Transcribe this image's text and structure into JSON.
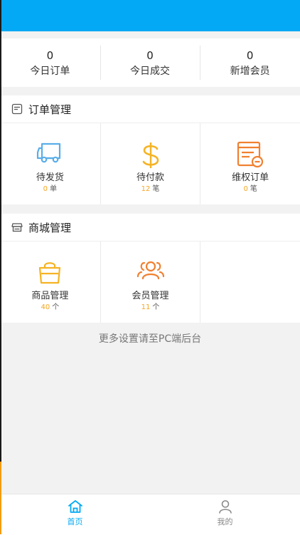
{
  "stats": [
    {
      "value": "0",
      "label": "今日订单"
    },
    {
      "value": "0",
      "label": "今日成交"
    },
    {
      "value": "0",
      "label": "新增会员"
    }
  ],
  "orders": {
    "title": "订单管理",
    "items": [
      {
        "label": "待发货",
        "count": "0",
        "unit": "单",
        "icon": "truck-icon"
      },
      {
        "label": "待付款",
        "count": "12",
        "unit": "笔",
        "icon": "dollar-icon"
      },
      {
        "label": "维权订单",
        "count": "0",
        "unit": "笔",
        "icon": "dispute-order-icon"
      }
    ]
  },
  "mall": {
    "title": "商城管理",
    "items": [
      {
        "label": "商品管理",
        "count": "40",
        "unit": "个",
        "icon": "shopping-bag-icon"
      },
      {
        "label": "会员管理",
        "count": "11",
        "unit": "个",
        "icon": "members-icon"
      }
    ]
  },
  "footer_note": "更多设置请至PC端后台",
  "tabs": [
    {
      "label": "首页",
      "icon": "home-icon",
      "active": true
    },
    {
      "label": "我的",
      "icon": "user-icon",
      "active": false
    }
  ],
  "colors": {
    "header": "#03a9f4",
    "accent": "#03a9f4",
    "count": "#f5a623"
  }
}
